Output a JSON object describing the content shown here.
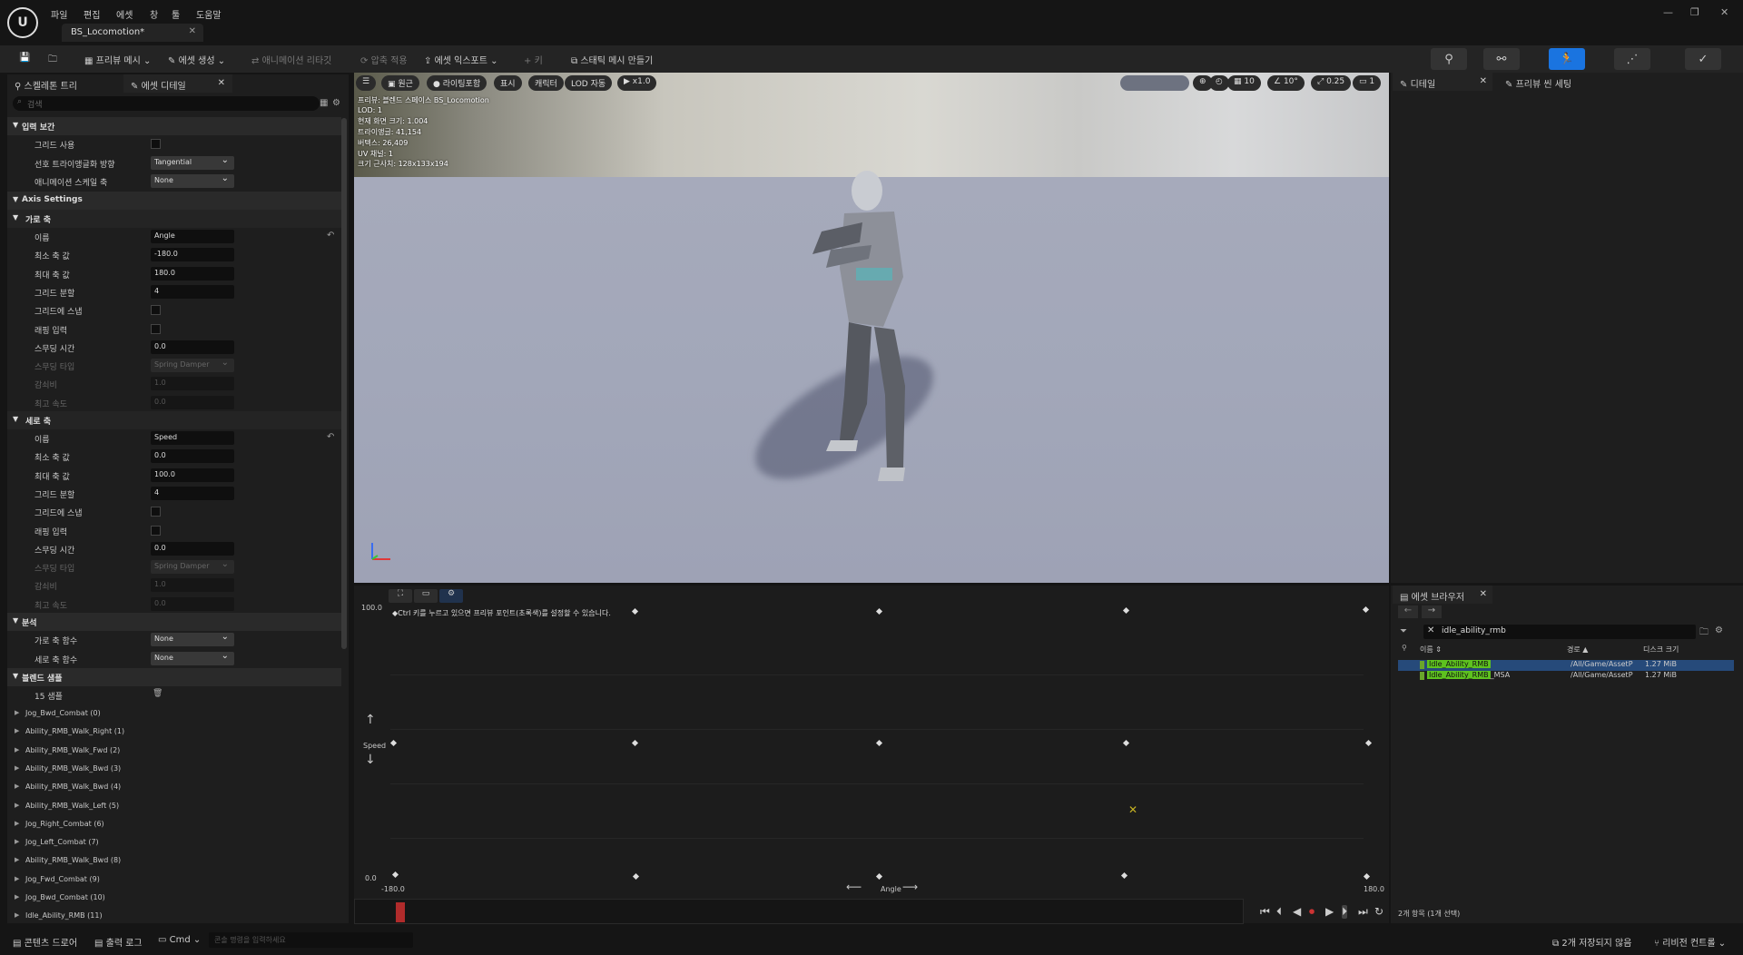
{
  "app": {
    "document_tab": "BS_Locomotion*",
    "menu": [
      "파일",
      "편집",
      "에셋",
      "창",
      "툴",
      "도움말"
    ]
  },
  "toolbar": {
    "preview_mesh": "프리뷰 메시",
    "create_asset": "에셋 생성",
    "animation_retarget": "애니메이션 리타깃",
    "compress": "압축 적용",
    "asset_export": "에셋 익스포트",
    "key": "키",
    "make_static_mesh": "스태틱 메시 만들기"
  },
  "left_panel": {
    "tab_skeleton_tree": "스켈레톤 트리",
    "tab_asset_details": "에셋 디테일",
    "search_placeholder": "검색",
    "sections": {
      "input": "입력 보간",
      "axis_settings": "Axis Settings",
      "horizontal": "가로 축",
      "vertical": "세로 축",
      "analysis": "분석",
      "blend_samples": "블렌드 샘플"
    },
    "input_rows": [
      {
        "label": "그리드 사용",
        "type": "checkbox"
      },
      {
        "label": "선호 트라이앵글화 방향",
        "value": "Tangential",
        "type": "dropdown"
      },
      {
        "label": "애니메이션 스케일 축",
        "value": "None",
        "type": "dropdown"
      }
    ],
    "horizontal_rows": [
      {
        "label": "이름",
        "value": "Angle",
        "type": "text"
      },
      {
        "label": "최소 축 값",
        "value": "-180.0",
        "type": "text"
      },
      {
        "label": "최대 축 값",
        "value": "180.0",
        "type": "text"
      },
      {
        "label": "그리드 분할",
        "value": "4",
        "type": "text"
      },
      {
        "label": "그리드에 스냅",
        "type": "checkbox"
      },
      {
        "label": "래핑 입력",
        "type": "checkbox"
      },
      {
        "label": "스무딩 시간",
        "value": "0.0",
        "type": "text"
      },
      {
        "label": "스무딩 타입",
        "value": "Spring Damper",
        "type": "dropdown",
        "dim": true
      },
      {
        "label": "감쇠비",
        "value": "1.0",
        "type": "text",
        "dim": true
      },
      {
        "label": "최고 속도",
        "value": "0.0",
        "type": "text",
        "dim": true
      }
    ],
    "vertical_rows": [
      {
        "label": "이름",
        "value": "Speed",
        "type": "text"
      },
      {
        "label": "최소 축 값",
        "value": "0.0",
        "type": "text"
      },
      {
        "label": "최대 축 값",
        "value": "100.0",
        "type": "text"
      },
      {
        "label": "그리드 분할",
        "value": "4",
        "type": "text"
      },
      {
        "label": "그리드에 스냅",
        "type": "checkbox"
      },
      {
        "label": "래핑 입력",
        "type": "checkbox"
      },
      {
        "label": "스무딩 시간",
        "value": "0.0",
        "type": "text"
      },
      {
        "label": "스무딩 타입",
        "value": "Spring Damper",
        "type": "dropdown",
        "dim": true
      },
      {
        "label": "감쇠비",
        "value": "1.0",
        "type": "text",
        "dim": true
      },
      {
        "label": "최고 속도",
        "value": "0.0",
        "type": "text",
        "dim": true
      }
    ],
    "analysis_rows": [
      {
        "label": "가로 축 함수",
        "value": "None"
      },
      {
        "label": "세로 축 함수",
        "value": "None"
      }
    ],
    "samples_count": "15 샘플",
    "samples": [
      "Jog_Bwd_Combat (0)",
      "Ability_RMB_Walk_Right (1)",
      "Ability_RMB_Walk_Fwd (2)",
      "Ability_RMB_Walk_Bwd (3)",
      "Ability_RMB_Walk_Bwd (4)",
      "Ability_RMB_Walk_Left (5)",
      "Jog_Right_Combat (6)",
      "Jog_Left_Combat (7)",
      "Ability_RMB_Walk_Bwd (8)",
      "Jog_Fwd_Combat (9)",
      "Jog_Bwd_Combat (10)",
      "Idle_Ability_RMB (11)"
    ]
  },
  "viewport": {
    "btn_perspective": "원근",
    "btn_lighting": "라이팅포함",
    "btn_show": "표시",
    "btn_character": "캐릭터",
    "btn_lod": "LOD 자동",
    "btn_speed": "x1.0",
    "snap_grid": "10",
    "snap_angle": "10°",
    "snap_scale": "0.25",
    "camera_speed": "1",
    "stats": [
      "프리뷰: 블렌드 스페이스 BS_Locomotion",
      "LOD: 1",
      "현재 화면 크기: 1.004",
      "트라이앵글: 41,154",
      "버텍스: 26,409",
      "UV 채널: 1",
      "크기 근사치: 128x133x194"
    ]
  },
  "blend_space": {
    "y_max": "100.0",
    "y_min": "0.0",
    "x_min": "-180.0",
    "x_max": "180.0",
    "y_axis_name": "Speed",
    "x_axis_name": "Angle",
    "hint": "Ctrl 키를 누르고 있으면 프리뷰 포인트(초록색)를 설정할 수 있습니다."
  },
  "right_panel": {
    "tab_details": "디테일",
    "tab_preview_scene": "프리뷰 씬 세팅"
  },
  "asset_browser": {
    "tab": "에셋 브라우저",
    "search_value": "idle_ability_rmb",
    "col_name": "이름",
    "col_path": "경로",
    "col_size": "디스크 크기",
    "rows": [
      {
        "name_match": "Idle_Ability_RMB",
        "name_rest": "",
        "path": "/All/Game/AssetP",
        "size": "1.27 MiB"
      },
      {
        "name_match": "Idle_Ability_RMB",
        "name_rest": "_MSA",
        "path": "/All/Game/AssetP",
        "size": "1.27 MiB"
      }
    ],
    "count": "2개 항목 (1개 선택)"
  },
  "statusbar": {
    "content_drawer": "콘텐츠 드로어",
    "output_log": "출력 로그",
    "cmd": "Cmd",
    "cmd_placeholder": "콘솔 명령을 입력하세요",
    "unsaved": "2개 저장되지 않음",
    "revision": "리비전 컨트롤"
  }
}
